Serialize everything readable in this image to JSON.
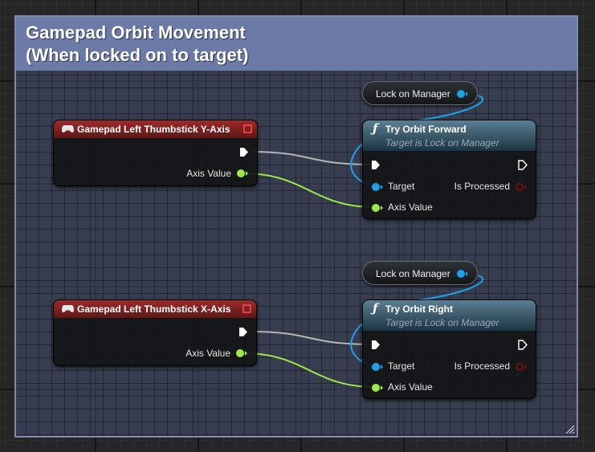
{
  "comment": {
    "title_line1": "Gamepad Orbit Movement",
    "title_line2": "(When locked on to target)",
    "color": "#6b7aa7"
  },
  "events": [
    {
      "title": "Gamepad Left Thumbstick Y-Axis",
      "output_label": "Axis Value",
      "icon": "gamepad-icon"
    },
    {
      "title": "Gamepad Left Thumbstick X-Axis",
      "output_label": "Axis Value",
      "icon": "gamepad-icon"
    }
  ],
  "getters": [
    {
      "label": "Lock on Manager"
    },
    {
      "label": "Lock on Manager"
    }
  ],
  "functions": [
    {
      "title": "Try Orbit Forward",
      "subtitle": "Target is Lock on Manager",
      "target_label": "Target",
      "output_label": "Is Processed",
      "input_label": "Axis Value",
      "icon": "function-icon"
    },
    {
      "title": "Try Orbit Right",
      "subtitle": "Target is Lock on Manager",
      "target_label": "Target",
      "output_label": "Is Processed",
      "input_label": "Axis Value",
      "icon": "function-icon"
    }
  ],
  "colors": {
    "event_header": "#9c2a2a",
    "function_header": "#1c3442",
    "float_pin": "#9fe84a",
    "object_pin": "#1aa3e8",
    "bool_pin": "#7a0f0f",
    "exec_wire": "#c9c9c9"
  }
}
